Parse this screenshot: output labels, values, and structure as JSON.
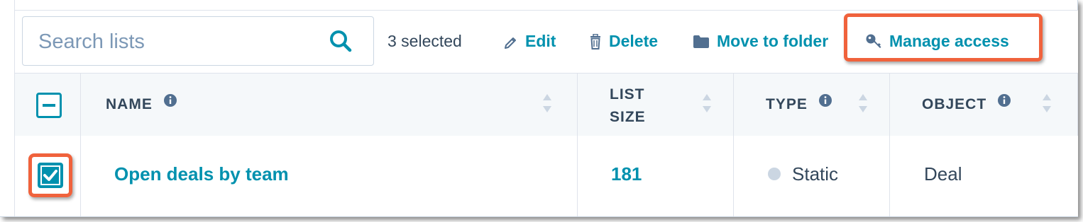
{
  "search": {
    "placeholder": "Search lists",
    "value": ""
  },
  "toolbar": {
    "selected_count_text": "3 selected",
    "actions": [
      {
        "label": "Edit",
        "icon": "pencil-icon"
      },
      {
        "label": "Delete",
        "icon": "trash-icon"
      },
      {
        "label": "Move to folder",
        "icon": "folder-icon"
      },
      {
        "label": "Manage access",
        "icon": "key-icon"
      }
    ]
  },
  "table": {
    "columns": [
      {
        "label": "NAME",
        "info": true,
        "sortable": true
      },
      {
        "label_line1": "LIST",
        "label_line2": "SIZE",
        "info": false,
        "sortable": true
      },
      {
        "label": "TYPE",
        "info": true,
        "sortable": true
      },
      {
        "label": "OBJECT",
        "info": true,
        "sortable": true
      }
    ],
    "rows": [
      {
        "checked": true,
        "name": "Open deals by team",
        "list_size": "181",
        "type": "Static",
        "object": "Deal"
      }
    ]
  },
  "colors": {
    "accent": "#0091ae",
    "text": "#33475b",
    "highlight": "#f0623c",
    "border": "#dfe3eb",
    "header_bg": "#f5f8fa",
    "status_dot": "#cbd6e2"
  }
}
